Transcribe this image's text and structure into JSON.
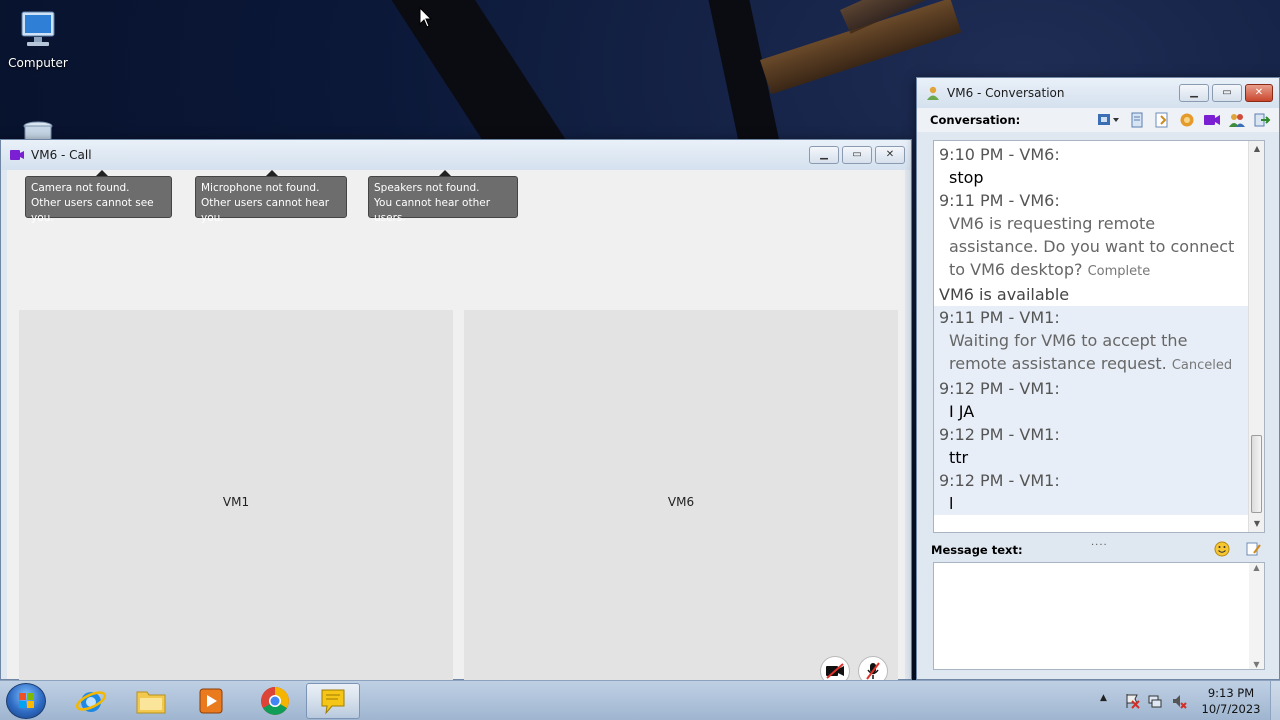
{
  "desktop": {
    "icons": [
      {
        "label": "Computer"
      },
      {
        "label": "Recycle Bin"
      }
    ]
  },
  "call_window": {
    "title": "VM6 - Call",
    "tooltips": [
      {
        "line1": "Camera not found.",
        "line2": "Other users cannot see you."
      },
      {
        "line1": "Microphone not found.",
        "line2": "Other users cannot hear you."
      },
      {
        "line1": "Speakers not found.",
        "line2": "You cannot hear other users."
      }
    ],
    "panes": [
      {
        "label": "VM1"
      },
      {
        "label": "VM6"
      }
    ],
    "controls": [
      "camera-off-icon",
      "microphone-off-icon"
    ]
  },
  "conversation_window": {
    "title": "VM6 - Conversation",
    "toolbar_label": "Conversation:",
    "messages": [
      {
        "header": "9:10 PM - VM6:",
        "body": "stop"
      },
      {
        "header": "9:11 PM - VM6:",
        "body": "VM6 is requesting remote assistance. Do you want to connect to VM6 desktop?",
        "status": "Complete"
      },
      {
        "system": "VM6 is available"
      },
      {
        "header": "9:11 PM - VM1:",
        "body": "Waiting for VM6 to accept the remote assistance request.",
        "status": "Canceled"
      },
      {
        "header": "9:12 PM - VM1:",
        "body": "I JA"
      },
      {
        "header": "9:12 PM - VM1:",
        "body": "ttr"
      },
      {
        "header": "9:12 PM - VM1:",
        "body": "l"
      }
    ],
    "splitter": "....",
    "message_label": "Message text:",
    "message_value": ""
  },
  "taskbar": {
    "apps": [
      "internet-explorer-icon",
      "file-explorer-icon",
      "media-player-icon",
      "chrome-icon",
      "messenger-icon"
    ],
    "clock_time": "9:13 PM",
    "clock_date": "10/7/2023"
  },
  "colors": {
    "accent": "#7a1fd1",
    "close_button": "#c9462d",
    "tooltip_bg": "#6d6d6d",
    "video_pane": "#e3e3e3"
  }
}
